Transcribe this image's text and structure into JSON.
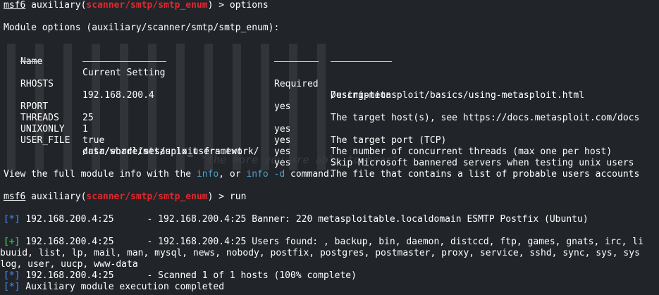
{
  "prompt": {
    "msf": "msf6",
    "module_type": "auxiliary",
    "module_path": "scanner/smtp/smtp_enum",
    "suffix": " > "
  },
  "commands": [
    "options",
    "run"
  ],
  "module_options_header": "Module options (auxiliary/scanner/smtp/smtp_enum):",
  "table": {
    "headers": [
      "Name",
      "Current Setting",
      "Required",
      "Description"
    ],
    "rows": [
      {
        "name": "RHOSTS",
        "setting": "192.168.200.4",
        "required": "yes",
        "desc1": "The target host(s), see https://docs.metasploit.com/docs",
        "desc2": "/using-metasploit/basics/using-metasploit.html"
      },
      {
        "name": "RPORT",
        "setting": "25",
        "required": "yes",
        "desc1": "The target port (TCP)"
      },
      {
        "name": "THREADS",
        "setting": "1",
        "required": "yes",
        "desc1": "The number of concurrent threads (max one per host)"
      },
      {
        "name": "UNIXONLY",
        "setting": "true",
        "required": "yes",
        "desc1": "Skip Microsoft bannered servers when testing unix users"
      },
      {
        "name": "USER_FILE",
        "setting": "/usr/share/metasploit-framework/",
        "setting2": "data/wordlists/unix_users.txt",
        "required": "yes",
        "desc1": "The file that contains a list of probable users accounts",
        "desc2": "."
      }
    ]
  },
  "info_line": {
    "before": "View the full module info with the ",
    "info": "info",
    "mid": ", or ",
    "info_d": "info -d",
    "after": " command."
  },
  "output": [
    {
      "tag": "[*]",
      "host": "192.168.200.4:25",
      "text": "      - 192.168.200.4:25 Banner: 220 metasploitable.localdomain ESMTP Postfix (Ubuntu)"
    },
    {
      "tag": "[+]",
      "host": "192.168.200.4:25",
      "text": "      - 192.168.200.4:25 Users found: , backup, bin, daemon, distccd, ftp, games, gnats, irc, li"
    },
    {
      "text": "buuid, list, lp, mail, man, mysql, news, nobody, postfix, postgres, postmaster, proxy, service, sshd, sync, sys, sys"
    },
    {
      "text": "log, user, uucp, www-data"
    },
    {
      "tag": "[*]",
      "host": "192.168.200.4:25",
      "text": "      - Scanned 1 of 1 hosts (100% complete)"
    },
    {
      "tag": "[*]",
      "text": " Auxiliary module execution completed"
    }
  ],
  "watermark_text": "\"the more you are able to hear\"",
  "colors": {
    "background": "#212429",
    "prompt_red": "#e0282e",
    "info_cyan": "#4ea3c9",
    "tag_blue": "#3b6fc9",
    "tag_green": "#2fb33d"
  }
}
